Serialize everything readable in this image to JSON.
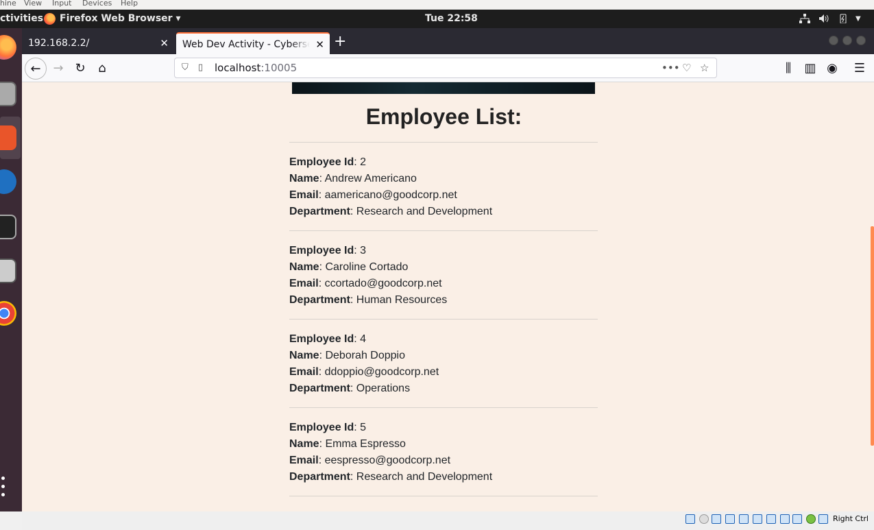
{
  "vbox_menu": [
    "hine",
    "View",
    "Input",
    "Devices",
    "Help"
  ],
  "topbar": {
    "activities": "ctivities",
    "app_menu": "Firefox Web Browser ▾",
    "clock": "Tue 22:58"
  },
  "tabs": [
    {
      "title": "192.168.2.2/",
      "active": false
    },
    {
      "title": "Web Dev Activity - Cybersecurity",
      "active": true
    }
  ],
  "urlbar": {
    "host": "localhost",
    "port": ":10005"
  },
  "page": {
    "heading": "Employee List:",
    "labels": {
      "id": "Employee Id",
      "name": "Name",
      "email": "Email",
      "department": "Department"
    },
    "employees": [
      {
        "id": "2",
        "name": "Andrew Americano",
        "email": "aamericano@goodcorp.net",
        "department": "Research and Development"
      },
      {
        "id": "3",
        "name": "Caroline Cortado",
        "email": "ccortado@goodcorp.net",
        "department": "Human Resources"
      },
      {
        "id": "4",
        "name": "Deborah Doppio",
        "email": "ddoppio@goodcorp.net",
        "department": "Operations"
      },
      {
        "id": "5",
        "name": "Emma Espresso",
        "email": "eespresso@goodcorp.net",
        "department": "Research and Development"
      }
    ]
  },
  "statusbar": {
    "hostkey": "Right Ctrl"
  },
  "colors": {
    "page_bg": "#faefe6",
    "tab_accent": "#ff7139",
    "dock": "#3b2a35"
  }
}
